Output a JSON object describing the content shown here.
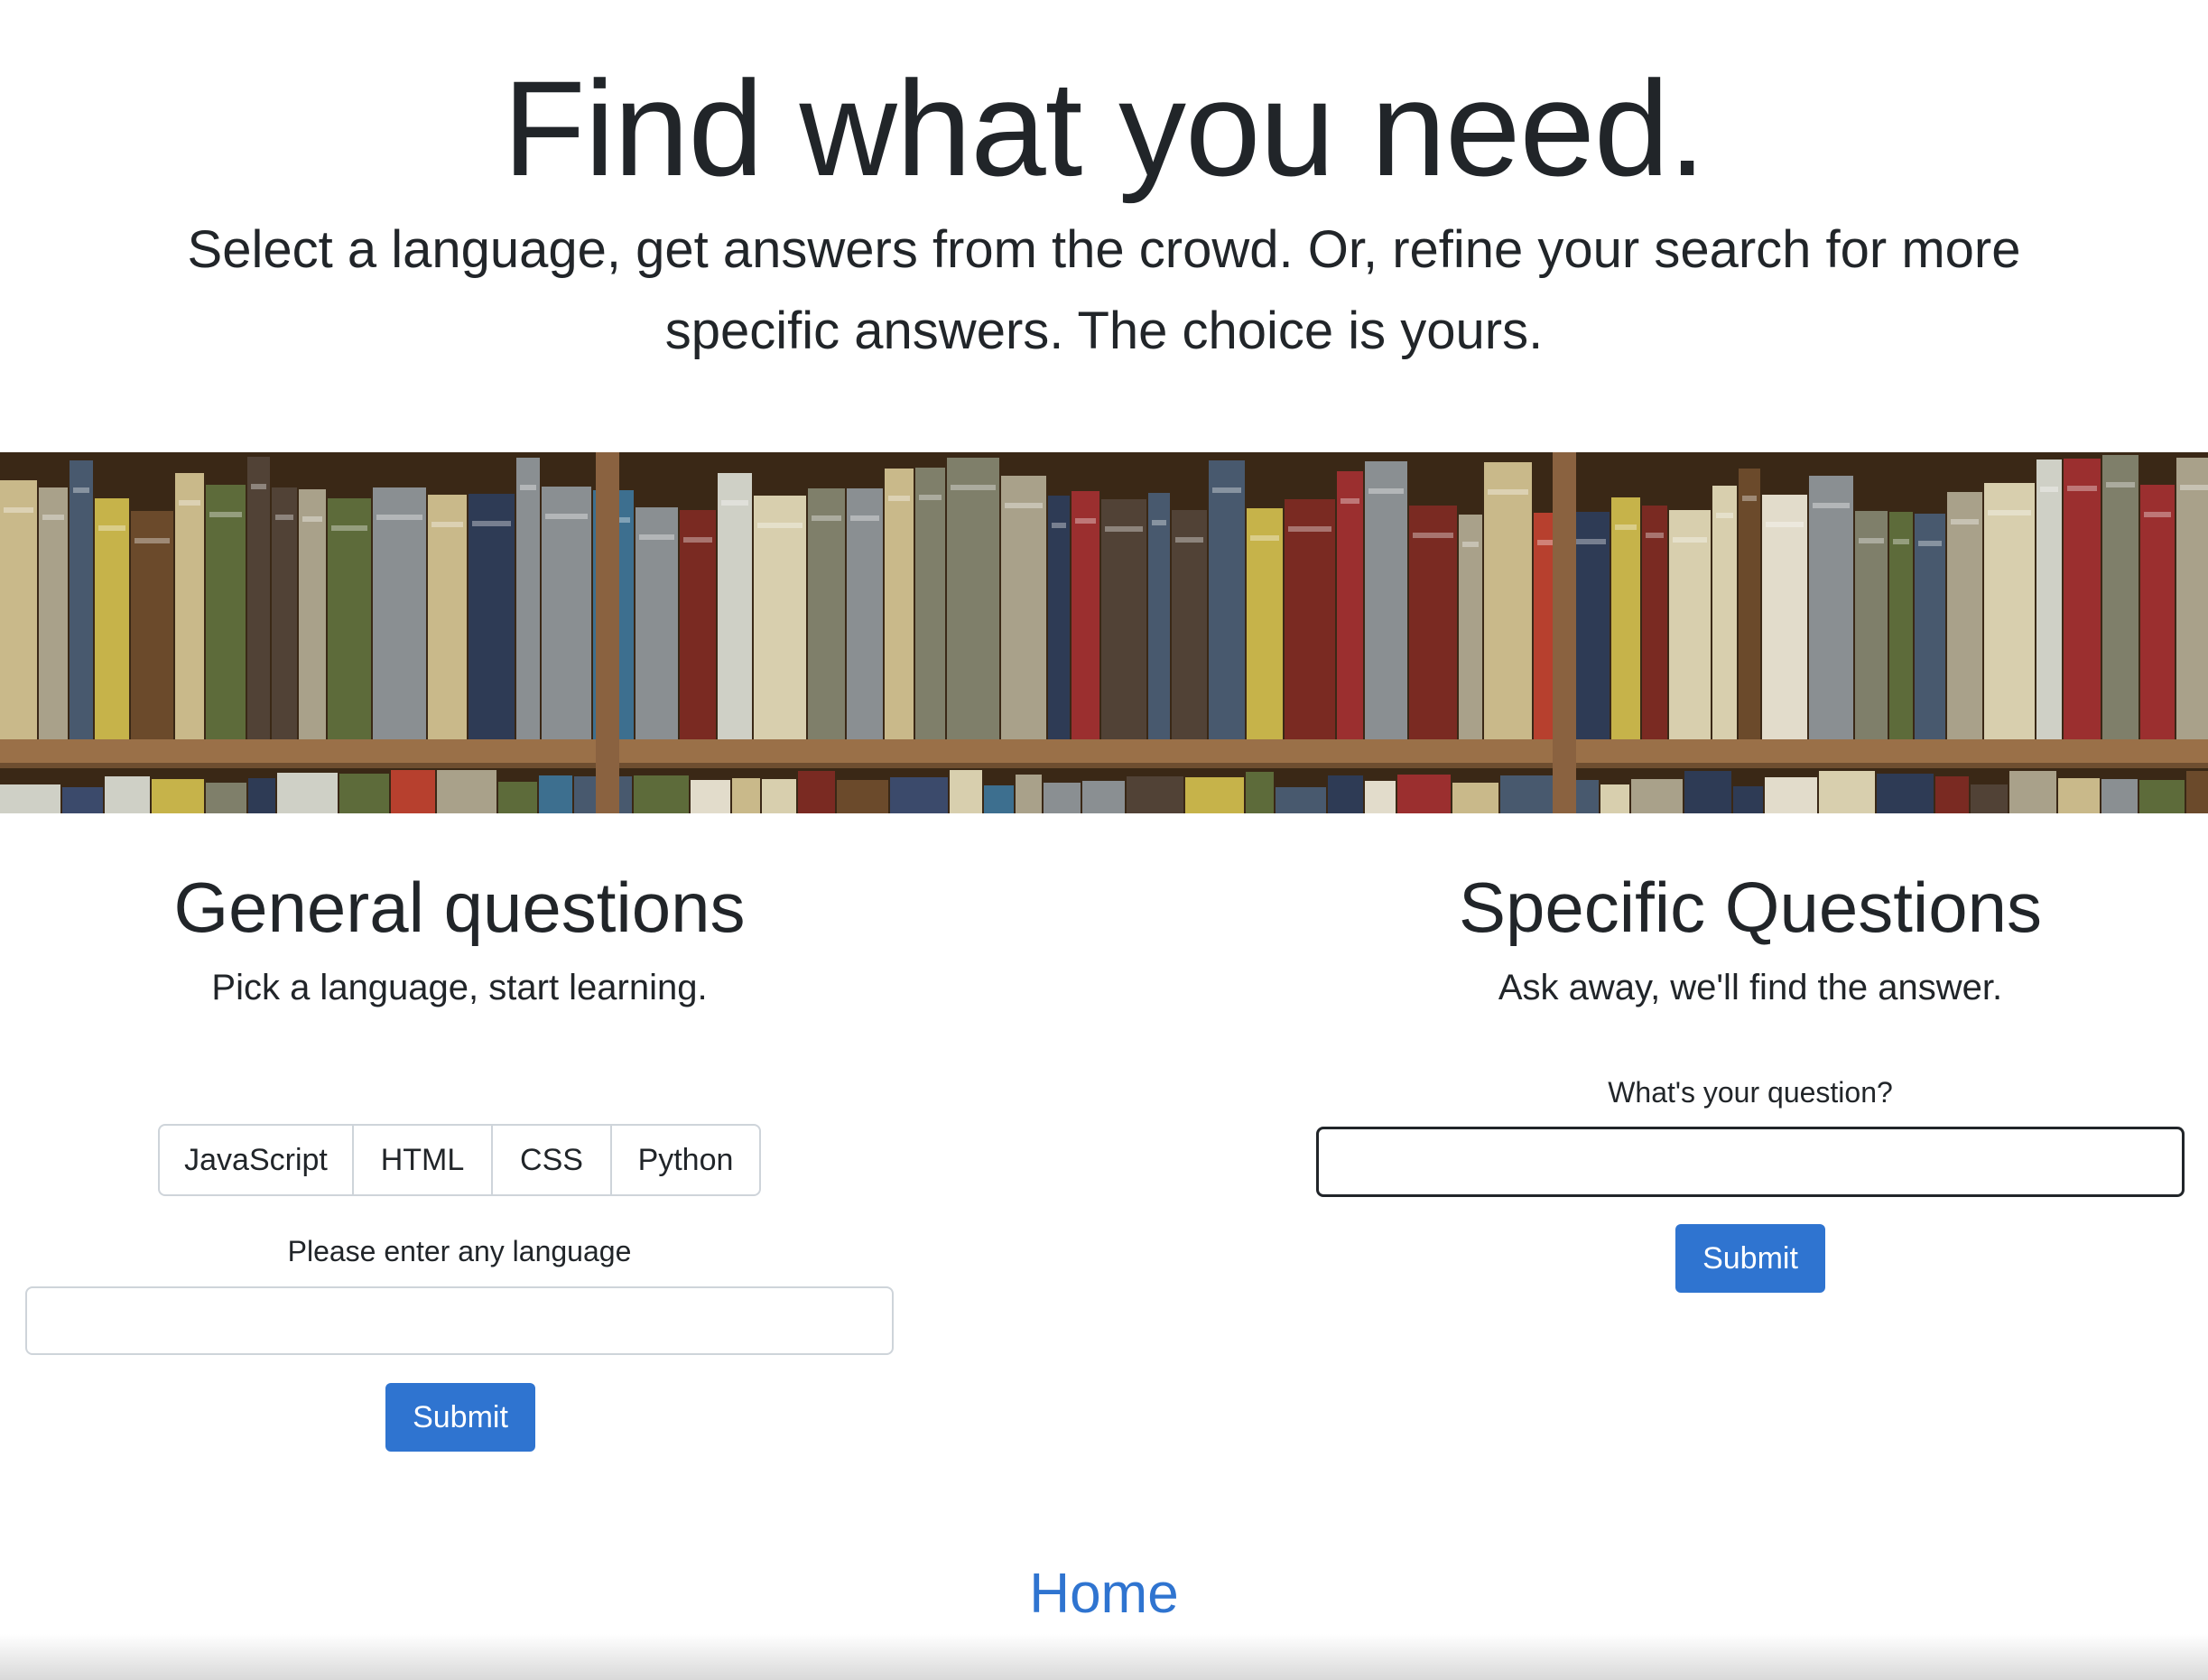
{
  "hero": {
    "title": "Find what you need.",
    "lead": "Select a language, get answers from the crowd. Or, refine your search for more specific answers. The choice is yours."
  },
  "banner": {
    "image": "bookshelf-photo"
  },
  "general": {
    "title": "General questions",
    "lead": "Pick a language, start learning.",
    "languages": [
      "JavaScript",
      "HTML",
      "CSS",
      "Python"
    ],
    "input_label": "Please enter any language",
    "input_value": "",
    "submit_label": "Submit"
  },
  "specific": {
    "title": "Specific Questions",
    "lead": "Ask away, we'll find the answer.",
    "input_label": "What's your question?",
    "input_value": "",
    "submit_label": "Submit"
  },
  "footer": {
    "home_label": "Home"
  },
  "colors": {
    "primary": "#2f74d0",
    "text": "#212529",
    "border": "#ced4da"
  }
}
